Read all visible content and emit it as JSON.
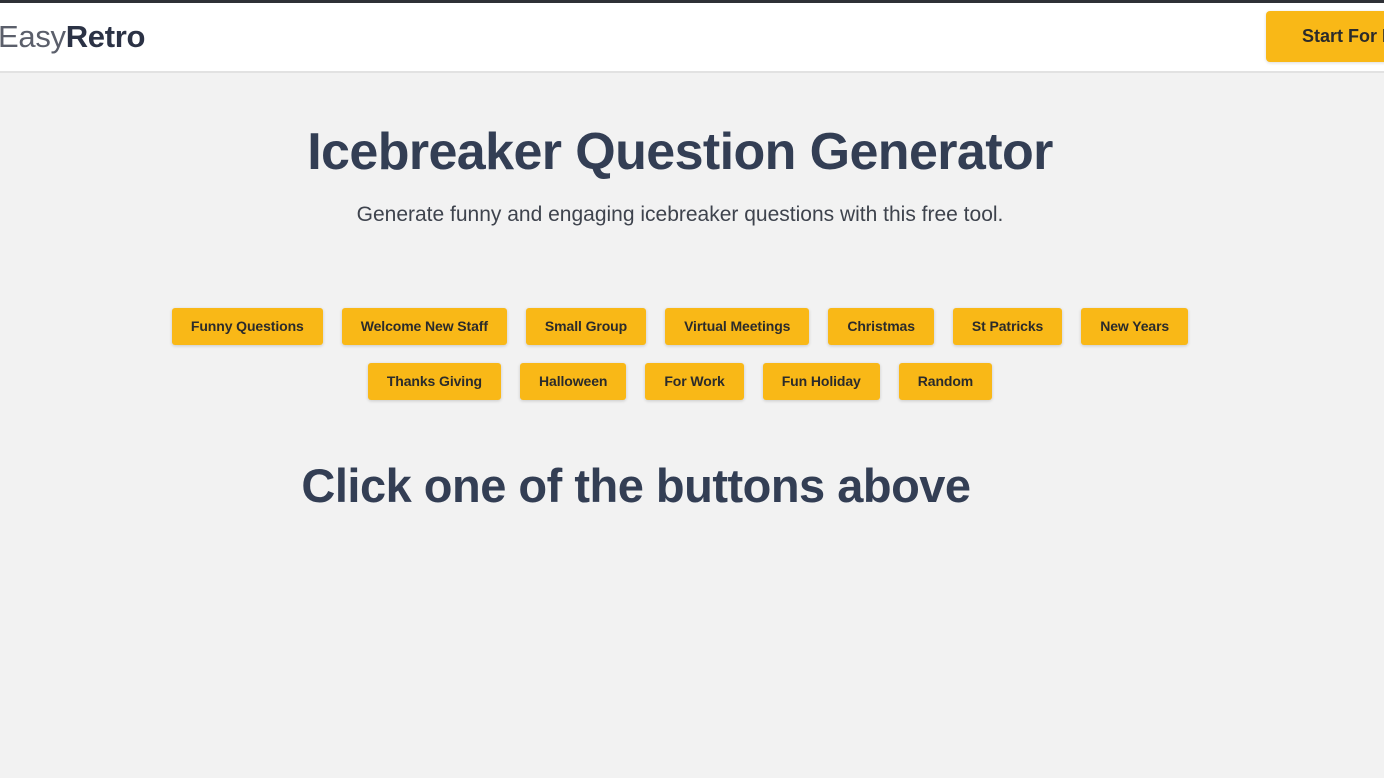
{
  "colors": {
    "accent_yellow": "#f9b817",
    "heading_navy": "#333e54",
    "page_background": "#f2f2f2",
    "header_background": "#ffffff",
    "header_border": "#e2e2e2",
    "button_text": "#2b2b2b"
  },
  "header": {
    "brand_light": "Easy",
    "brand_bold": "Retro",
    "cta_label": "Start For Free"
  },
  "main": {
    "title": "Icebreaker Question Generator",
    "subtitle": "Generate funny and engaging icebreaker questions with this free tool.",
    "result_heading": "Click one of the buttons above",
    "category_rows": [
      [
        {
          "label": "Funny Questions"
        },
        {
          "label": "Welcome New Staff"
        },
        {
          "label": "Small Group"
        },
        {
          "label": "Virtual Meetings"
        },
        {
          "label": "Christmas"
        },
        {
          "label": "St Patricks"
        },
        {
          "label": "New Years"
        }
      ],
      [
        {
          "label": "Thanks Giving"
        },
        {
          "label": "Halloween"
        },
        {
          "label": "For Work"
        },
        {
          "label": "Fun Holiday"
        },
        {
          "label": "Random"
        }
      ]
    ]
  }
}
